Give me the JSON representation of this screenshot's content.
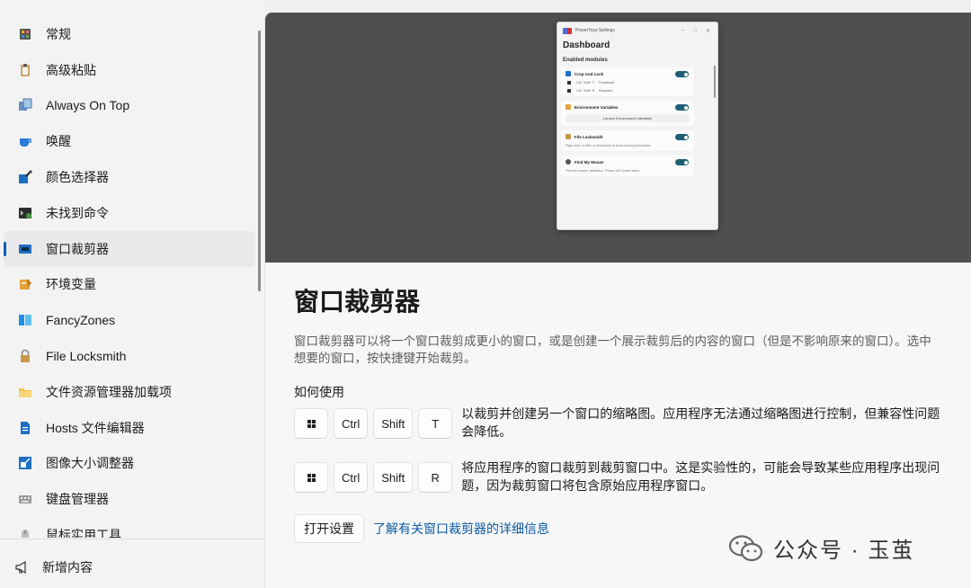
{
  "sidebar": {
    "items": [
      {
        "label": "常规",
        "icon": "general-settings-icon"
      },
      {
        "label": "高级粘贴",
        "icon": "advanced-paste-icon"
      },
      {
        "label": "Always On Top",
        "icon": "always-on-top-icon"
      },
      {
        "label": "唤醒",
        "icon": "awake-cup-icon"
      },
      {
        "label": "颜色选择器",
        "icon": "color-picker-icon"
      },
      {
        "label": "未找到命令",
        "icon": "command-not-found-icon"
      },
      {
        "label": "窗口裁剪器",
        "icon": "crop-and-lock-icon",
        "selected": true
      },
      {
        "label": "环境变量",
        "icon": "environment-variables-icon"
      },
      {
        "label": "FancyZones",
        "icon": "fancyzones-icon"
      },
      {
        "label": "File Locksmith",
        "icon": "file-locksmith-lock-icon"
      },
      {
        "label": "文件资源管理器加载项",
        "icon": "file-explorer-folder-icon"
      },
      {
        "label": "Hosts 文件编辑器",
        "icon": "hosts-file-icon"
      },
      {
        "label": "图像大小调整器",
        "icon": "image-resizer-icon"
      },
      {
        "label": "键盘管理器",
        "icon": "keyboard-icon"
      },
      {
        "label": "鼠标实用工具",
        "icon": "mouse-icon"
      }
    ],
    "bottom": {
      "label": "新增内容",
      "icon": "megaphone-icon"
    }
  },
  "preview": {
    "window_title": "PowerToys Settings",
    "heading": "Dashboard",
    "section": "Enabled modules",
    "modules": [
      {
        "name": "Crop And Lock",
        "rows": [
          [
            "Ctrl",
            "Shift",
            "T",
            "Thumbnail"
          ],
          [
            "Ctrl",
            "Shift",
            "R",
            "Reparent"
          ]
        ]
      },
      {
        "name": "Environment Variables",
        "button": "Launch Environment Variables"
      },
      {
        "name": "File Locksmith",
        "desc": "Right-click on files or directories to show running processes"
      },
      {
        "name": "Find My Mouse",
        "desc": "Find the mouse: Activation: Press Left Control twice"
      }
    ]
  },
  "main": {
    "title": "窗口裁剪器",
    "description": "窗口裁剪器可以将一个窗口裁剪成更小的窗口，或是创建一个展示裁剪后的内容的窗口（但是不影响原来的窗口）。选中想要的窗口，按快捷键开始裁剪。",
    "how_to_use": "如何使用",
    "shortcuts": [
      {
        "keys": [
          "Ctrl",
          "Shift",
          "T"
        ],
        "text": "以裁剪并创建另一个窗口的缩略图。应用程序无法通过缩略图进行控制，但兼容性问题会降低。"
      },
      {
        "keys": [
          "Ctrl",
          "Shift",
          "R"
        ],
        "text": "将应用程序的窗口裁剪到裁剪窗口中。这是实验性的，可能会导致某些应用程序出现问题，因为裁剪窗口将包含原始应用程序窗口。"
      }
    ],
    "open_settings": "打开设置",
    "learn_more": "了解有关窗口裁剪器的详细信息"
  },
  "watermark": {
    "text": "公众号 · 玉茧",
    "icon": "wechat-logo-icon"
  },
  "colors": {
    "accent": "#0a5fb4",
    "link": "#0b5aa6",
    "hero_bg": "#4f4f50",
    "toggle": "#1e5e74"
  }
}
